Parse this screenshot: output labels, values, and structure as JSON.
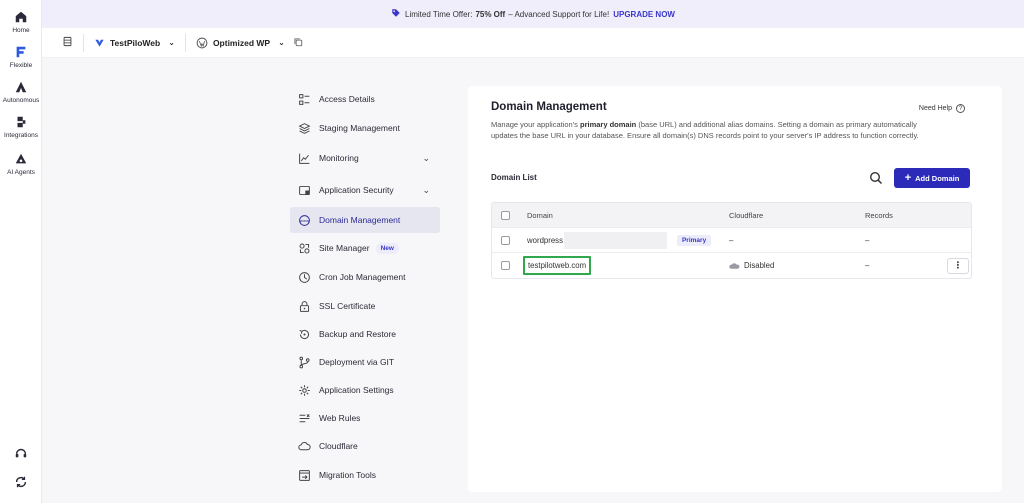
{
  "rail": {
    "items": [
      {
        "label": "Home",
        "icon": "home-icon"
      },
      {
        "label": "Flexible",
        "icon": "flexible-icon"
      },
      {
        "label": "Autonomous",
        "icon": "autonomous-icon"
      },
      {
        "label": "Integrations",
        "icon": "integrations-icon"
      },
      {
        "label": "AI Agents",
        "icon": "ai-agents-icon"
      }
    ]
  },
  "banner": {
    "text_before": "Limited Time Offer:",
    "highlight": "75% Off",
    "text_after": "– Advanced Support for Life!",
    "cta": "UPGRADE NOW"
  },
  "topbar": {
    "server_name": "TestPiloWeb",
    "app_name": "Optimized WP"
  },
  "menu": {
    "items": [
      {
        "label": "Access Details",
        "icon": "access-details-icon"
      },
      {
        "label": "Staging Management",
        "icon": "staging-icon"
      },
      {
        "label": "Monitoring",
        "icon": "monitoring-icon",
        "chevron": "⌄"
      },
      {
        "label": "Application Security",
        "icon": "shield-icon",
        "chevron": "⌄"
      },
      {
        "label": "Domain Management",
        "icon": "www-icon",
        "active": true
      },
      {
        "label": "Site Manager",
        "icon": "site-manager-icon",
        "badge": "New"
      },
      {
        "label": "Cron Job Management",
        "icon": "cron-icon"
      },
      {
        "label": "SSL Certificate",
        "icon": "lock-icon"
      },
      {
        "label": "Backup and Restore",
        "icon": "backup-icon"
      },
      {
        "label": "Deployment via GIT",
        "icon": "git-icon"
      },
      {
        "label": "Application Settings",
        "icon": "gear-icon"
      },
      {
        "label": "Web Rules",
        "icon": "web-rules-icon"
      },
      {
        "label": "Cloudflare",
        "icon": "cloud-icon"
      },
      {
        "label": "Migration Tools",
        "icon": "migration-icon"
      }
    ]
  },
  "card": {
    "title": "Domain Management",
    "need_help": "Need Help",
    "description_1": "Manage your application's",
    "description_bold": "primary domain",
    "description_2": "(base URL) and additional alias domains. Setting a domain as primary automatically updates the base URL in your database. Ensure all domain(s) DNS records point to your server's IP address to function correctly.",
    "list_title": "Domain List",
    "add_button": "Add Domain",
    "columns": {
      "domain": "Domain",
      "cloudflare": "Cloudflare",
      "records": "Records"
    },
    "rows": [
      {
        "domain": "wordpress",
        "badge": "Primary",
        "cloudflare": "–",
        "records": "–"
      },
      {
        "domain": "testpilotweb.com",
        "cloudflare": "Disabled",
        "records": "–",
        "menu": "⋮"
      }
    ]
  },
  "colors": {
    "accent": "#2c2ab8",
    "highlight": "#31a84b",
    "banner_bg": "#f1eefb"
  }
}
